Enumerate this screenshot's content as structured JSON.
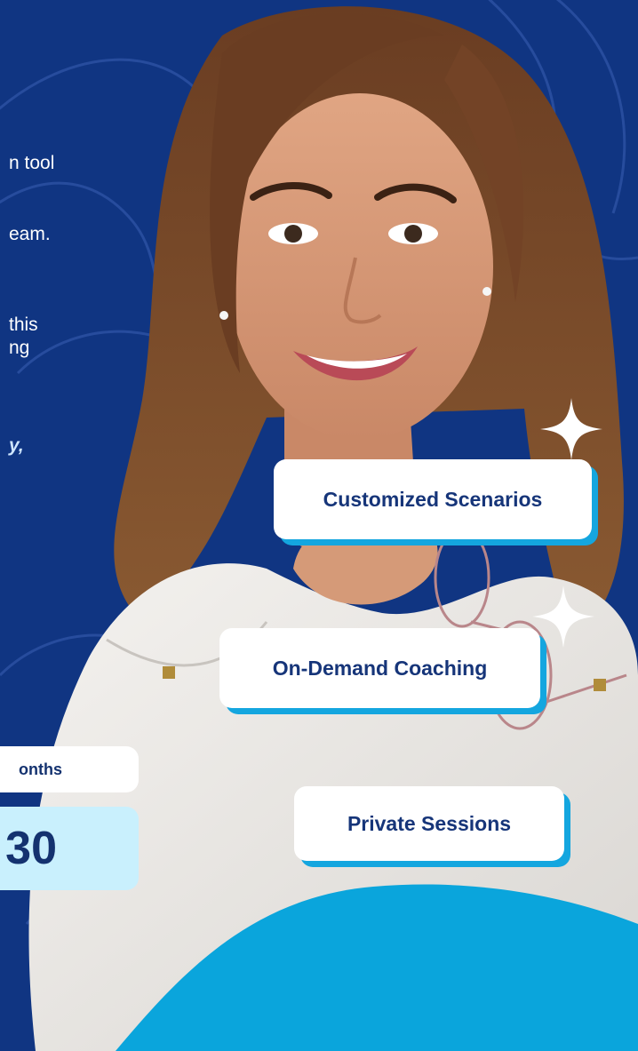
{
  "intro": {
    "lines": [
      "n tool",
      "eam.",
      "this",
      "ng",
      "y,"
    ]
  },
  "stat": {
    "label": "onths",
    "value": "30"
  },
  "features": [
    {
      "label": "Customized Scenarios"
    },
    {
      "label": "On-Demand Coaching"
    },
    {
      "label": "Private Sessions"
    }
  ],
  "colors": {
    "background": "#103582",
    "accent": "#14a6df",
    "pill_text": "#163579",
    "stat_bg": "#c9f0fd"
  },
  "icons": [
    "sparkle-icon",
    "sparkle-icon"
  ]
}
